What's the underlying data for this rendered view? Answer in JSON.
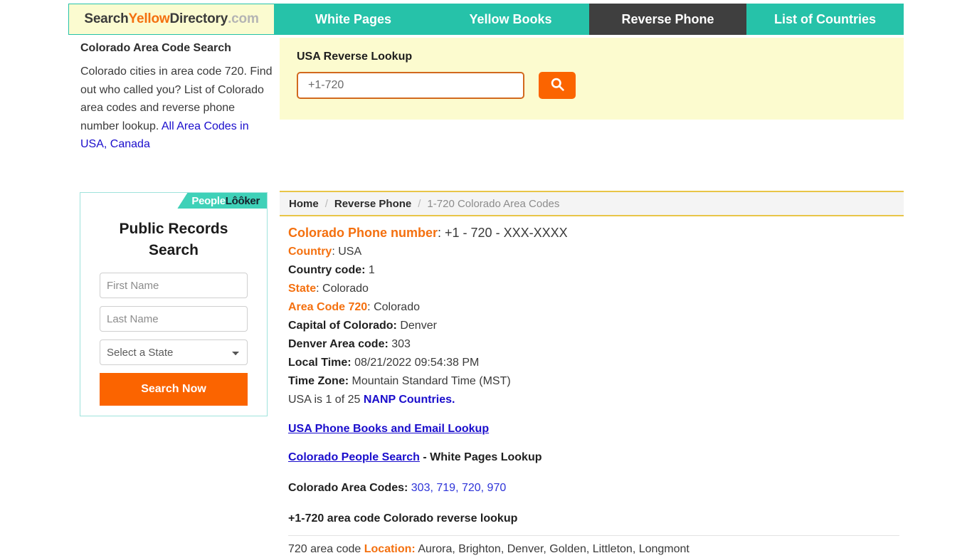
{
  "nav": {
    "logo": {
      "part1": "Search",
      "part2": "Yellow",
      "part3": "Directory",
      "part4": ".com"
    },
    "items": [
      {
        "label": "White Pages",
        "active": false
      },
      {
        "label": "Yellow Books",
        "active": false
      },
      {
        "label": "Reverse Phone",
        "active": true
      },
      {
        "label": "List of Countries",
        "active": false
      }
    ]
  },
  "sidebar": {
    "title": "Colorado Area Code Search",
    "description": "Colorado cities in area code 720. Find out who called you? List of Colorado area codes and reverse phone number lookup.",
    "link": "All Area Codes in USA, Canada"
  },
  "widget": {
    "brand_people": "People",
    "brand_looker": "Lôôker",
    "heading": "Public Records Search",
    "first_name_placeholder": "First Name",
    "first_name_value": "",
    "last_name_placeholder": "Last Name",
    "last_name_value": "",
    "state_selected": "Select a State",
    "state_options": [
      "Select a State"
    ],
    "submit_label": "Search Now"
  },
  "search": {
    "title": "USA Reverse Lookup",
    "input_value": "",
    "input_placeholder": "+1-720",
    "button_icon": "search-icon"
  },
  "breadcrumb": {
    "home": "Home",
    "section": "Reverse Phone",
    "separator": "/",
    "current": "1-720 Colorado Area Codes"
  },
  "details": {
    "phone_label": "Colorado Phone number",
    "phone_value": ": +1 - 720 - XXX-XXXX",
    "country_label": "Country",
    "country_value": ": USA",
    "country_code_label": "Country code:",
    "country_code_value": "1",
    "state_label": "State",
    "state_value": ": Colorado",
    "area_code_label": "Area Code 720",
    "area_code_value": ": Colorado",
    "capital_label": "Capital of Colorado:",
    "capital_value": "Denver",
    "denver_area_label": "Denver Area code:",
    "denver_area_value": "303",
    "local_time_label": "Local Time:",
    "local_time_value": "08/21/2022 09:54:38 PM",
    "time_zone_label": "Time Zone:",
    "time_zone_value": "Mountain Standard Time (MST)",
    "nanp_prefix": "USA is 1 of 25 ",
    "nanp_link": "NANP Countries.",
    "phone_books_link": "USA Phone Books and Email Lookup",
    "people_search_link": "Colorado People Search",
    "people_search_suffix": " - White Pages Lookup",
    "area_codes_label": "Colorado Area Codes: ",
    "area_codes": [
      "303",
      "719",
      "720",
      "970"
    ],
    "reverse_lookup_heading": "+1-720 area code Colorado reverse lookup",
    "location_prefix": "720 area code ",
    "location_label": "Location:",
    "location_value": " Aurora, Brighton, Denver, Golden, Littleton, Longmont"
  }
}
